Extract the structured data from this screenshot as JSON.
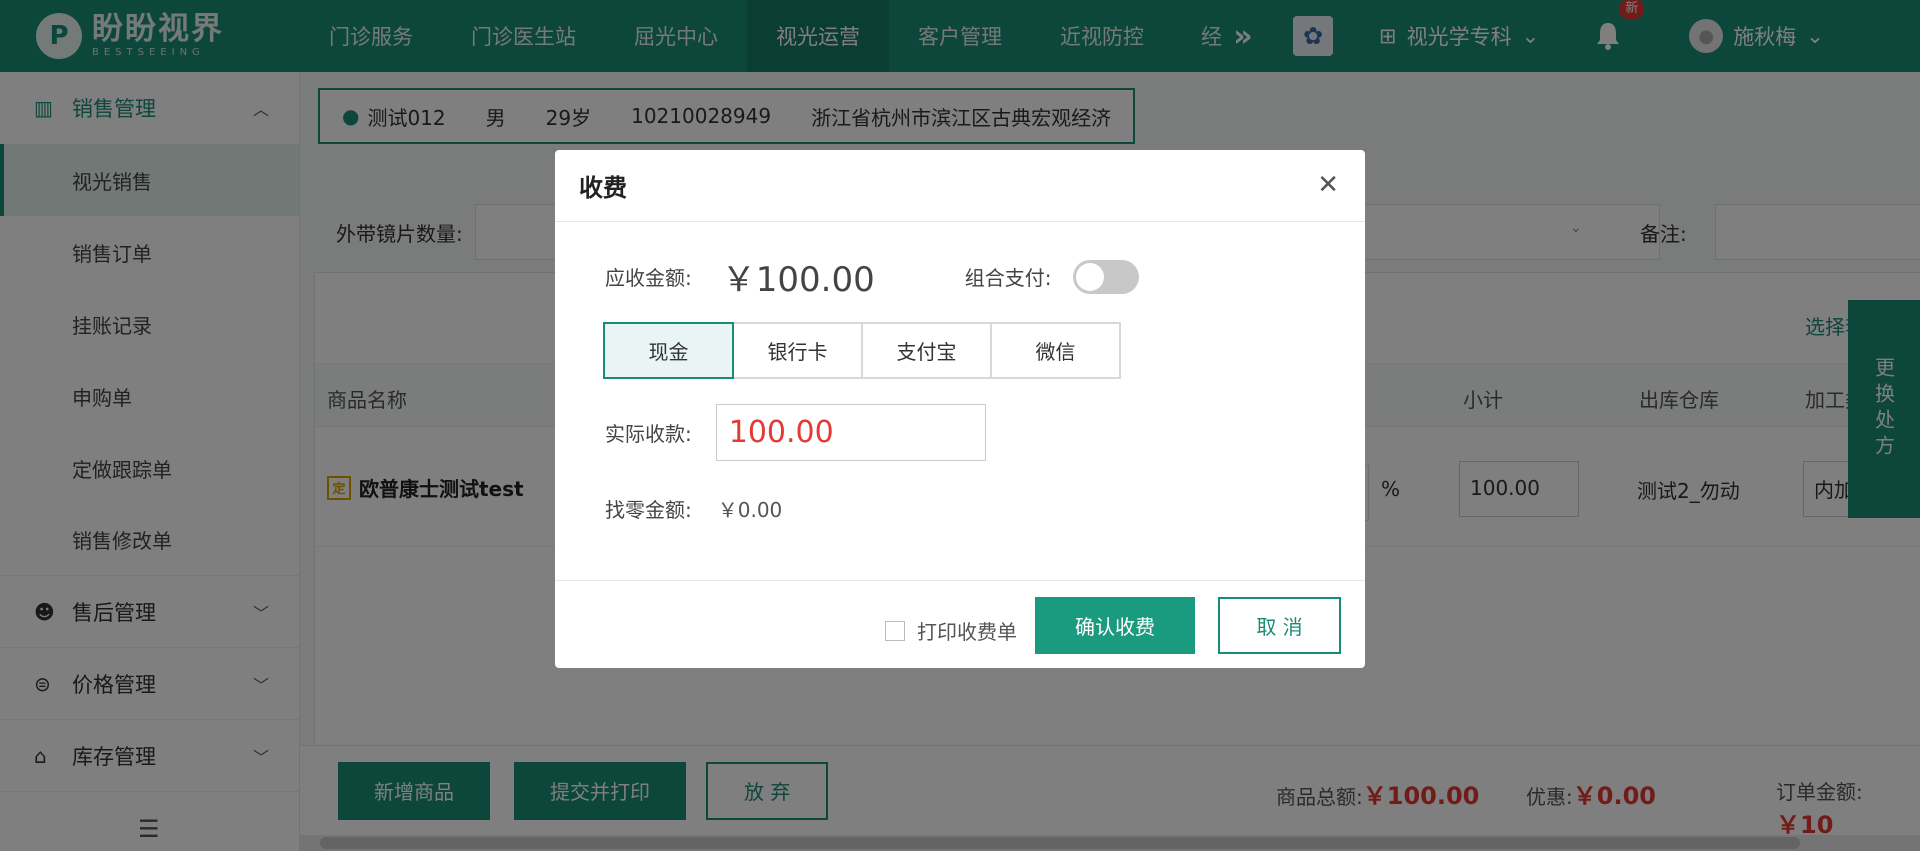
{
  "app": {
    "logo_cn": "盼盼视界",
    "logo_en": "BESTSEEING"
  },
  "nav": {
    "items": [
      "门诊服务",
      "门诊医生站",
      "屈光中心",
      "视光运营",
      "客户管理",
      "近视防控"
    ],
    "active_index": 3,
    "cut_item": "经",
    "department": "视光学专科",
    "notification_badge": "新",
    "user_name": "施秋梅"
  },
  "sidebar": {
    "group_sales": "销售管理",
    "items": [
      "视光销售",
      "销售订单",
      "挂账记录",
      "申购单",
      "定做跟踪单",
      "销售修改单"
    ],
    "active_index": 0,
    "group_aftersales": "售后管理",
    "group_price": "价格管理",
    "group_stock": "库存管理"
  },
  "patient": {
    "name": "测试012",
    "gender": "男",
    "age": "29岁",
    "phone": "10210028949",
    "address": "浙江省杭州市滨江区古典宏观经济"
  },
  "filter": {
    "external_lens_label": "外带镜片数量:",
    "note_label": "备注:"
  },
  "table": {
    "choose_link": "选择套",
    "columns": {
      "name": "商品名称",
      "subtotal": "小计",
      "warehouse": "出库仓库",
      "process": "加工类"
    },
    "row": {
      "badge": "定",
      "name": "欧普康士测试test",
      "percent_sign": "%",
      "subtotal": "100.00",
      "warehouse": "测试2_勿动",
      "process": "内加工"
    }
  },
  "side_tab": "更换处方",
  "bottom": {
    "add_button": "新增商品",
    "submit_print_button": "提交并打印",
    "abandon_button": "放 弃",
    "goods_total_label": "商品总额:",
    "goods_total": "￥100.00",
    "discount_label": "优惠:",
    "discount": "￥0.00",
    "order_total_label": "订单金额:",
    "order_total": "￥10"
  },
  "modal": {
    "title": "收费",
    "close_icon": "close-icon",
    "due_label": "应收金额:",
    "due_amount": "￥100.00",
    "combo_label": "组合支付:",
    "combo_enabled": false,
    "payment_methods": [
      "现金",
      "银行卡",
      "支付宝",
      "微信"
    ],
    "payment_active_index": 0,
    "actual_label": "实际收款:",
    "actual_value": "100.00",
    "change_label": "找零金额:",
    "change_value": "￥0.00",
    "print_receipt_label": "打印收费单",
    "print_receipt_checked": false,
    "confirm_button": "确认收费",
    "cancel_button": "取 消"
  },
  "colors": {
    "brand": "#1a8c76",
    "confirm": "#1a9b7f",
    "amount_red": "#e53935"
  }
}
